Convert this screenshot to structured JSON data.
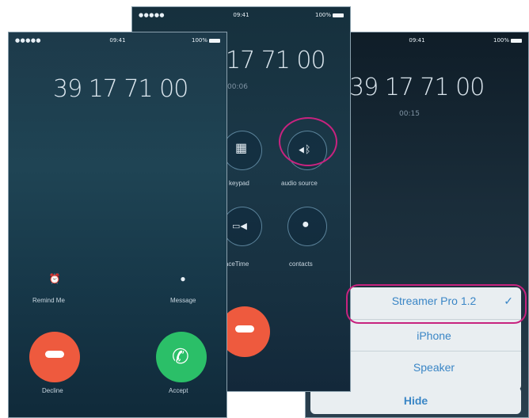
{
  "status": {
    "carrier": "●●●●● ",
    "time": "09:41",
    "battery": "100%"
  },
  "incoming": {
    "number": "39 17 71 00",
    "remind_label": "Remind Me",
    "message_label": "Message",
    "decline_label": "Decline",
    "accept_label": "Accept"
  },
  "incall": {
    "number": "17 71 00",
    "duration": "00:06",
    "keypad_label": "keypad",
    "audio_label": "audio source",
    "facetime_label": "FaceTime",
    "contacts_label": "contacts"
  },
  "audio_sheet": {
    "number": "39 17 71 00",
    "duration": "00:15",
    "options": [
      "Streamer Pro 1.2",
      "iPhone",
      "Speaker"
    ],
    "selected_check": "✓",
    "hide_label": "Hide"
  },
  "colors": {
    "highlight": "#c8237f",
    "decline": "#ee5a3e",
    "accept": "#2bbf68",
    "option_text": "#3a86c6"
  }
}
